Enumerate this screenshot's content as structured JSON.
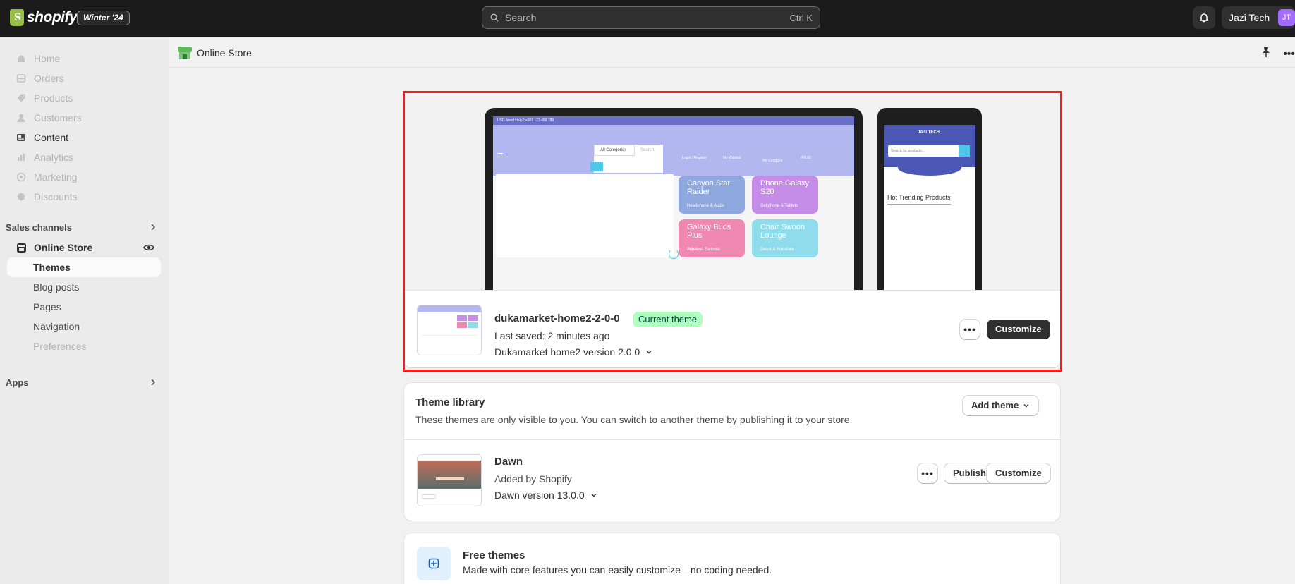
{
  "topbar": {
    "logo_text": "shopify",
    "edition": "Winter '24",
    "search_placeholder": "Search",
    "search_shortcut": "Ctrl K",
    "account_name": "Jazi Tech",
    "account_initials": "JT"
  },
  "sidebar": {
    "items": [
      {
        "label": "Home",
        "icon": "home-icon"
      },
      {
        "label": "Orders",
        "icon": "orders-icon"
      },
      {
        "label": "Products",
        "icon": "tag-icon"
      },
      {
        "label": "Customers",
        "icon": "person-icon"
      },
      {
        "label": "Content",
        "icon": "content-icon"
      },
      {
        "label": "Analytics",
        "icon": "analytics-icon"
      },
      {
        "label": "Marketing",
        "icon": "marketing-icon"
      },
      {
        "label": "Discounts",
        "icon": "discount-icon"
      }
    ],
    "sales_channels_label": "Sales channels",
    "online_store_label": "Online Store",
    "sub_items": [
      {
        "label": "Themes"
      },
      {
        "label": "Blog posts"
      },
      {
        "label": "Pages"
      },
      {
        "label": "Navigation"
      },
      {
        "label": "Preferences"
      }
    ],
    "apps_label": "Apps"
  },
  "page": {
    "title": "Online Store"
  },
  "current_theme": {
    "name": "dukamarket-home2-2-0-0",
    "badge": "Current theme",
    "last_saved": "Last saved: 2 minutes ago",
    "version": "Dukamarket home2 version 2.0.0",
    "customize_label": "Customize",
    "preview": {
      "topbar_text": "USD      Need Help? +001 123 456 789",
      "categories": "All Categories",
      "search": "Search",
      "login": "Login / Register",
      "wishlist": "My Wishlist",
      "compare": "My Compare",
      "cart": "R 0.00",
      "tiles": [
        {
          "title": "Canyon Star Raider",
          "sub": "Headphone & Audio",
          "color": "#8fa9e0"
        },
        {
          "title": "Phone Galaxy S20",
          "sub": "Cellphone & Tablets",
          "color": "#c58de8"
        },
        {
          "title": "Galaxy Buds Plus",
          "sub": "Wireless Earbuds",
          "color": "#f089b1"
        },
        {
          "title": "Chair Swoon Lounge",
          "sub": "Decor & Furniture",
          "color": "#8fdcec"
        }
      ],
      "phone_logo": "JAZI TECH",
      "phone_search": "Search for products...",
      "phone_heading": "Hot Trending Products"
    }
  },
  "library": {
    "title": "Theme library",
    "subtitle": "These themes are only visible to you. You can switch to another theme by publishing it to your store.",
    "add_theme_label": "Add theme",
    "themes": [
      {
        "name": "Dawn",
        "added_by": "Added by Shopify",
        "version": "Dawn version 13.0.0",
        "publish_label": "Publish",
        "customize_label": "Customize"
      }
    ]
  },
  "free_themes": {
    "title": "Free themes",
    "subtitle": "Made with core features you can easily customize—no coding needed."
  },
  "colors": {
    "topbar_bg": "#1a1a1a",
    "sidebar_bg": "#ebebeb",
    "badge_green": "#affebf",
    "highlight_red": "#ff1a1a",
    "avatar_purple": "#a36cff"
  }
}
